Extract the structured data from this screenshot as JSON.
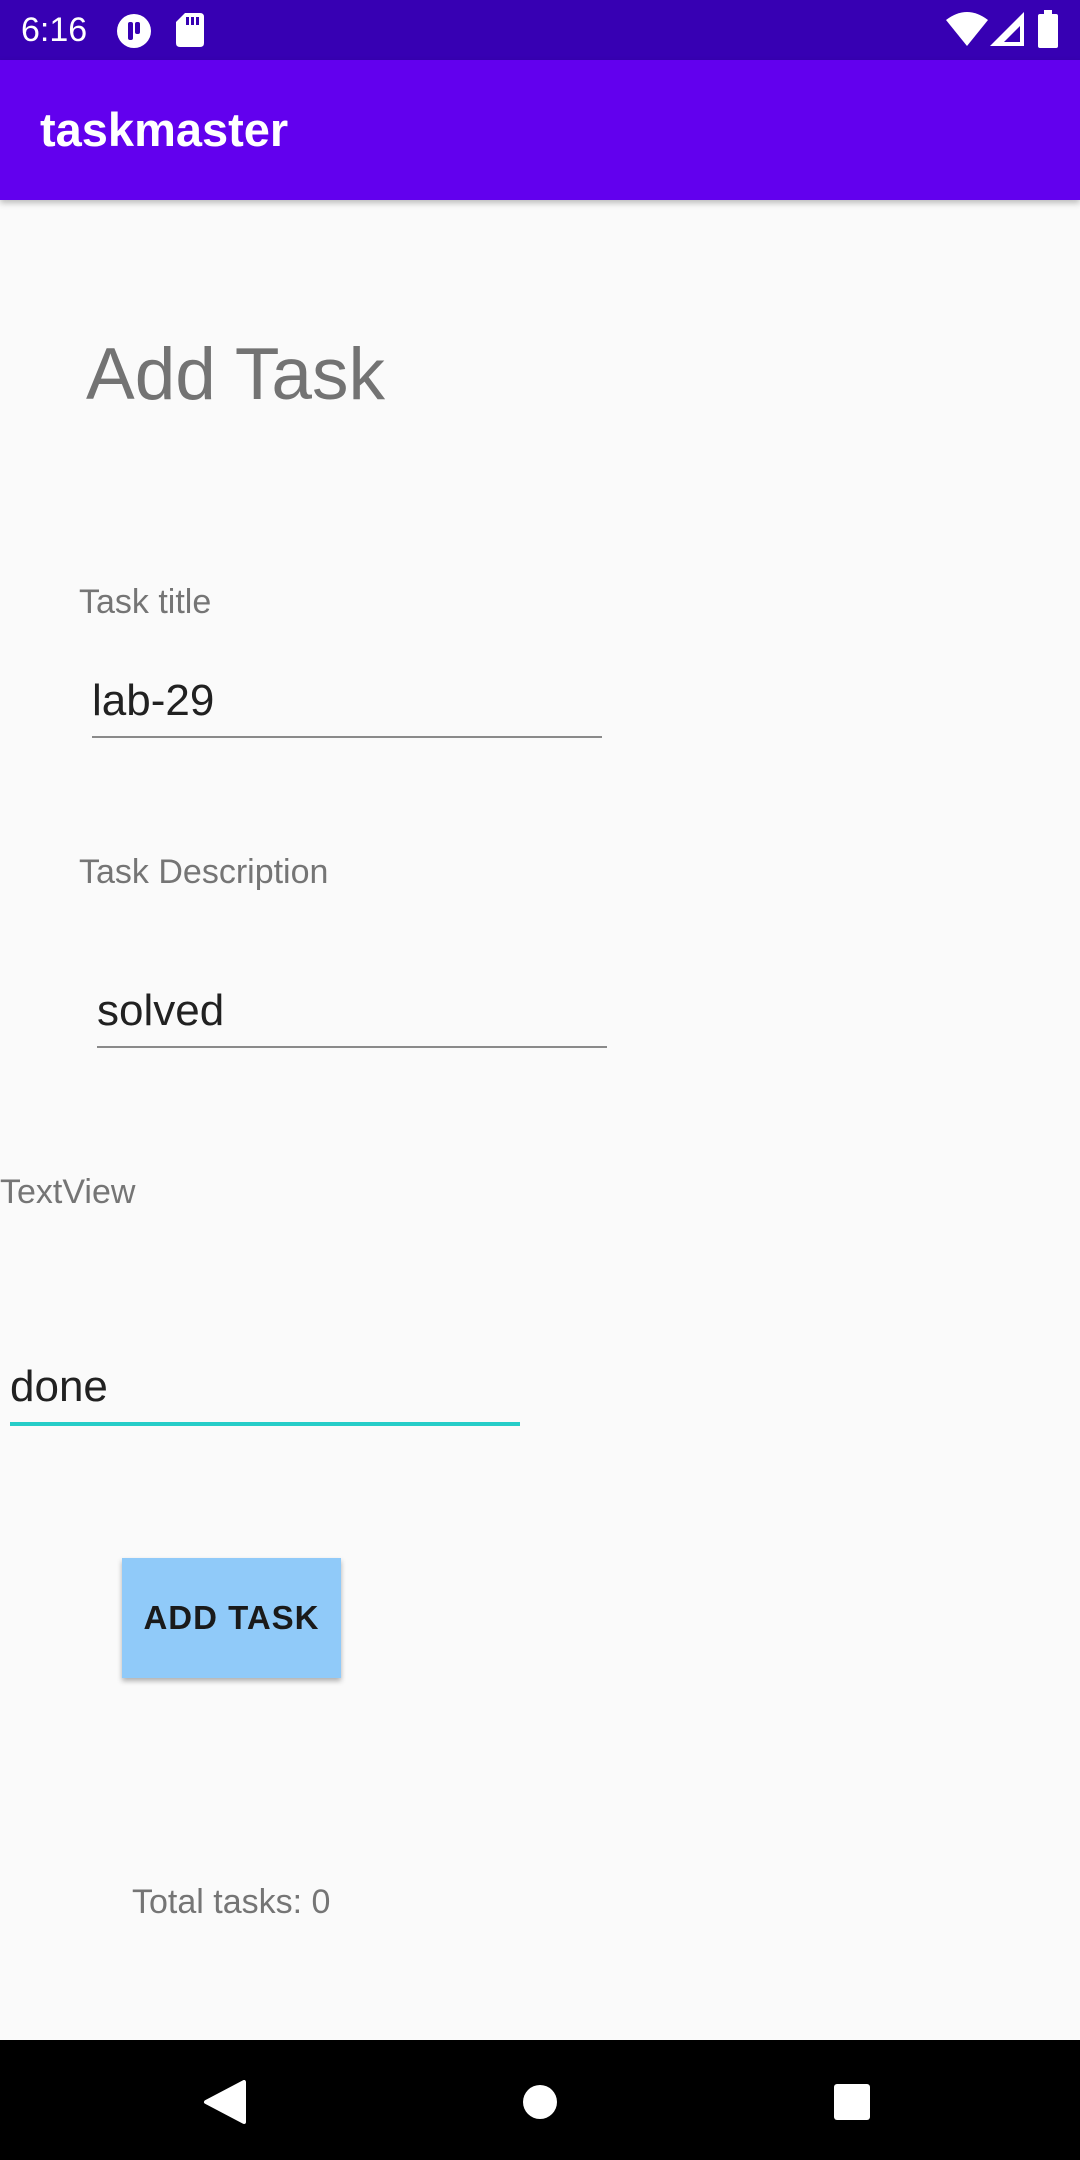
{
  "status_bar": {
    "time": "6:16",
    "icons": [
      "pocket-icon",
      "sd-card-icon",
      "wifi-icon",
      "signal-icon",
      "battery-icon"
    ]
  },
  "app_bar": {
    "title": "taskmaster",
    "color": "#6200EE",
    "status_color": "#3700B3"
  },
  "form": {
    "heading": "Add Task",
    "title_label": "Task title",
    "title_value": "lab-29",
    "description_label": "Task Description",
    "description_value": "solved",
    "state_label": "TextView",
    "state_value": "done",
    "focus_color": "#26CDC8"
  },
  "add_button": {
    "label": "ADD TASK",
    "color": "#90CAF9"
  },
  "total_tasks": "Total tasks: 0",
  "nav_bar": {
    "icons": [
      "back-icon",
      "home-icon",
      "recents-icon"
    ]
  }
}
